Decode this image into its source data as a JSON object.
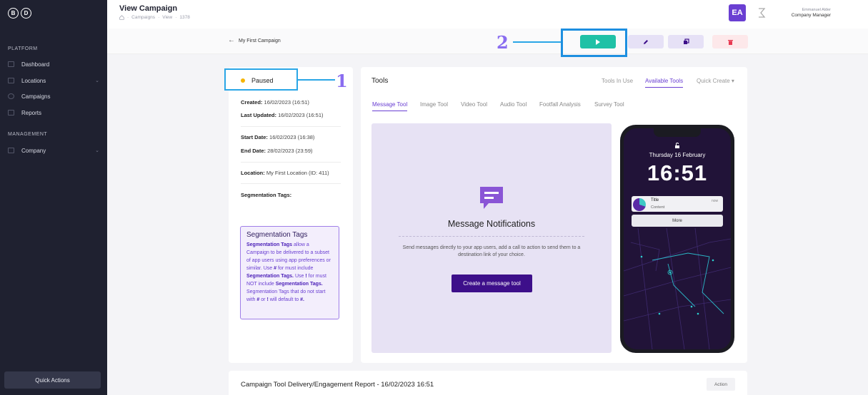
{
  "brand": {
    "logo_letters": [
      "B",
      "D"
    ]
  },
  "sidebar": {
    "platform_label": "PLATFORM",
    "platform_items": [
      {
        "label": "Dashboard",
        "icon": "dashboard-icon"
      },
      {
        "label": "Locations",
        "icon": "locations-icon",
        "expandable": true
      },
      {
        "label": "Campaigns",
        "icon": "campaigns-icon"
      },
      {
        "label": "Reports",
        "icon": "reports-icon"
      }
    ],
    "management_label": "MANAGEMENT",
    "management_items": [
      {
        "label": "Company",
        "icon": "company-icon",
        "expandable": true
      }
    ],
    "quick_actions_label": "Quick Actions"
  },
  "header": {
    "title": "View Campaign",
    "breadcrumb": [
      "Campaigns",
      "View",
      "1378"
    ],
    "user_name": "Emmanuel Alder",
    "user_role": "Company Manager",
    "avatar_initials": "EA"
  },
  "toolbar": {
    "campaign_name": "My First Campaign",
    "colors": {
      "play": "#1fc1a6",
      "edit": "#e6e1f6",
      "delete": "#fde8ea"
    }
  },
  "annotations": {
    "one": "1",
    "two": "2"
  },
  "campaign": {
    "status": "Paused",
    "status_color": "#f5b400",
    "created_label": "Created:",
    "created_value": "16/02/2023 (16:51)",
    "updated_label": "Last Updated:",
    "updated_value": "16/02/2023 (16:51)",
    "start_label": "Start Date:",
    "start_value": "16/02/2023 (16:38)",
    "end_label": "End Date:",
    "end_value": "28/02/2023 (23:59)",
    "location_label": "Location:",
    "location_value": "My First Location (ID: 411)",
    "seg_label": "Segmentation Tags:"
  },
  "seg_info": {
    "title": "Segmentation Tags",
    "p1_bold": "Segmentation Tags",
    "p1": " allow a Campaign to be delivered to a subset of app users using app preferences or similar. Use ",
    "hash": "#",
    "p2": " for must include ",
    "p2_bold": "Segmentation Tags.",
    "p3": " Use ",
    "bang": "!",
    "p4": " for must NOT include ",
    "p4_bold": "Segmentation Tags.",
    "p5": " Segmentation Tags that do not start with ",
    "p5_hash": "#",
    "p5_or": " or ",
    "p5_bang": "!",
    "p5_end": " will default to ",
    "p5_final": "#."
  },
  "tools": {
    "title": "Tools",
    "menu": [
      "Tools In Use",
      "Available Tools",
      "Quick Create"
    ],
    "tabs": [
      "Message Tool",
      "Image Tool",
      "Video Tool",
      "Audio Tool",
      "Footfall Analysis",
      "Survey Tool"
    ],
    "message": {
      "title": "Message Notifications",
      "description": "Send messages directly to your app users, add a call to action to send them to a destination link of your choice.",
      "button": "Create a message tool"
    }
  },
  "phone": {
    "date": "Thursday 16 February",
    "time": "16:51",
    "notif_title": "Title",
    "notif_content": "Content",
    "notif_time": "now",
    "more": "More"
  },
  "report": {
    "title": "Campaign Tool Delivery/Engagement Report - 16/02/2023 16:51",
    "action": "Action"
  }
}
